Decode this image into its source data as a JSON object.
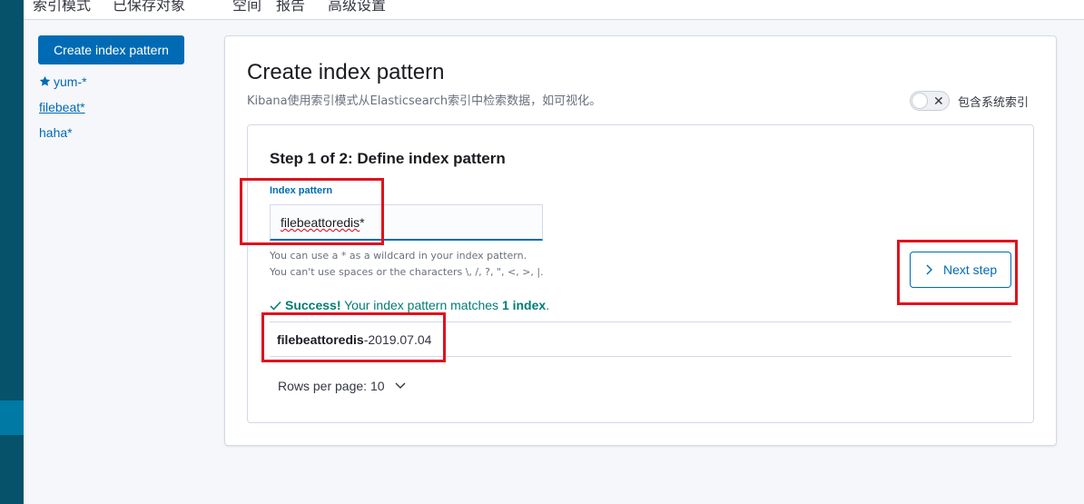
{
  "top_tabs": [
    "索引模式",
    "已保存对象",
    "空间",
    "报告",
    "高级设置"
  ],
  "sidebar": {
    "create_button_label": "Create index pattern",
    "items": [
      {
        "label": "yum-*",
        "default": true
      },
      {
        "label": "filebeat*",
        "selected": true
      },
      {
        "label": "haha*"
      }
    ]
  },
  "panel": {
    "title": "Create index pattern",
    "description": "Kibana使用索引模式从Elasticsearch索引中检索数据，如可视化。",
    "toggle_label": "包含系统索引",
    "toggle_icon": "close-icon"
  },
  "step": {
    "title": "Step 1 of 2: Define index pattern",
    "field_label": "Index pattern",
    "input_value_main": "filebeattoredis",
    "input_value_suffix": "*",
    "help_line1": "You can use a * as a wildcard in your index pattern.",
    "help_line2": "You can't use spaces or the characters \\, /, ?, \", <, >, |.",
    "next_button_label": "Next step",
    "success_prefix": "Success!",
    "success_middle": " Your index pattern matches ",
    "success_count": "1 index",
    "success_end": ".",
    "match_bold": "filebeattoredis",
    "match_rest": "-2019.07.04",
    "rows_per_page": "Rows per page: 10"
  },
  "colors": {
    "primary": "#006bb4",
    "success": "#017d73",
    "annotation": "#e0121c",
    "nav": "#05526a"
  }
}
